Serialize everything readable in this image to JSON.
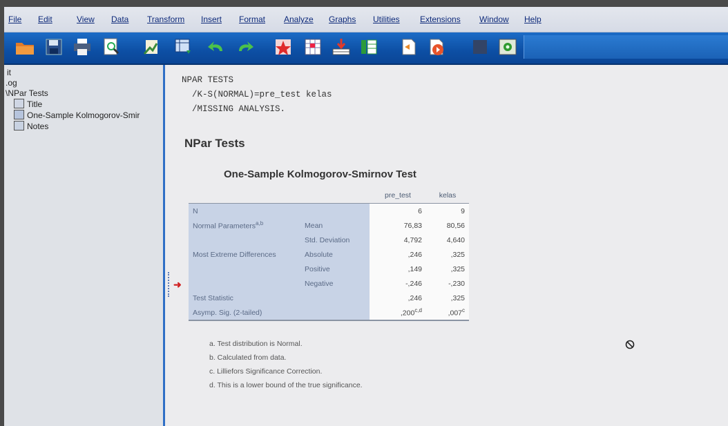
{
  "menu": {
    "items": [
      "File",
      "Edit",
      "View",
      "Data",
      "Transform",
      "Insert",
      "Format",
      "Analyze",
      "Graphs",
      "Utilities",
      "Extensions",
      "Window",
      "Help"
    ]
  },
  "toolbar": {
    "icons": [
      "open-folder-icon",
      "save-icon",
      "print-icon",
      "print-preview-icon",
      "export-icon",
      "goto-data-icon",
      "undo-icon",
      "redo-icon",
      "goto-case-icon",
      "goto-variable-icon",
      "variables-icon",
      "split-file-icon",
      "designate-window-icon",
      "run-script-icon",
      "stop-icon",
      "execute-icon"
    ]
  },
  "nav": {
    "line1": "it",
    "line2": ".og",
    "npar_tests": "NPar Tests",
    "title": "Title",
    "ks_test": "One-Sample Kolmogorov-Smir",
    "notes": "Notes"
  },
  "output": {
    "syntax": "NPAR TESTS\n  /K-S(NORMAL)=pre_test kelas\n  /MISSING ANALYSIS.",
    "section_title": "NPar Tests",
    "table_title": "One-Sample Kolmogorov-Smirnov Test",
    "arrow": "➜"
  },
  "table": {
    "col_headers": [
      "pre_test",
      "kelas"
    ],
    "rows": [
      {
        "label": "N",
        "sub": "",
        "a": "6",
        "b": "9"
      },
      {
        "label": "Normal Parameters",
        "label_sup": "a,b",
        "sub": "Mean",
        "a": "76,83",
        "b": "80,56"
      },
      {
        "label": "",
        "sub": "Std. Deviation",
        "a": "4,792",
        "b": "4,640"
      },
      {
        "label": "Most Extreme Differences",
        "sub": "Absolute",
        "a": ",246",
        "b": ",325"
      },
      {
        "label": "",
        "sub": "Positive",
        "a": ",149",
        "b": ",325"
      },
      {
        "label": "",
        "sub": "Negative",
        "a": "-,246",
        "b": "-,230"
      },
      {
        "label": "Test Statistic",
        "sub": "",
        "a": ",246",
        "b": ",325"
      },
      {
        "label": "Asymp. Sig. (2-tailed)",
        "sub": "",
        "a": ",200",
        "a_sup": "c,d",
        "b": ",007",
        "b_sup": "c"
      }
    ]
  },
  "footnotes": [
    "a. Test distribution is Normal.",
    "b. Calculated from data.",
    "c. Lilliefors Significance Correction.",
    "d. This is a lower bound of the true significance."
  ]
}
